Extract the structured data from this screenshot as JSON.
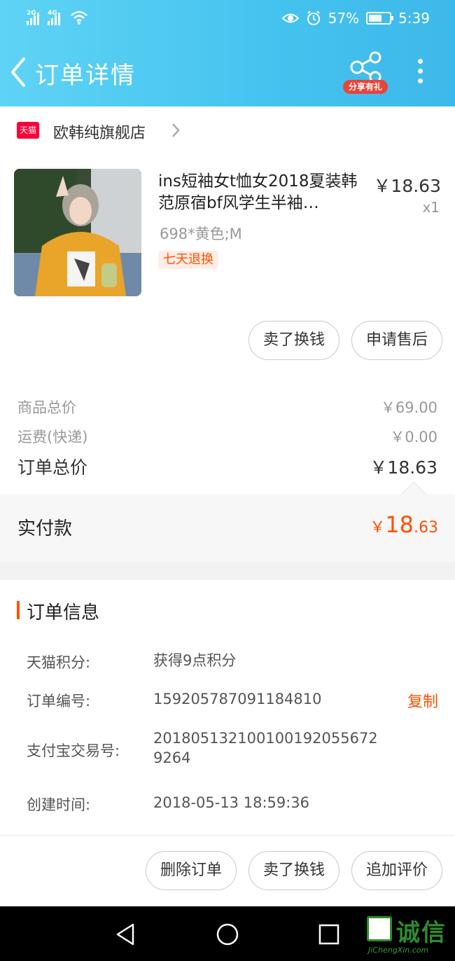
{
  "status_bar": {
    "sim1": "2G",
    "sim2": "4G",
    "battery": "57%",
    "time": "5:39"
  },
  "header": {
    "title": "订单详情",
    "share_label": "分享有礼"
  },
  "shop": {
    "badge": "天猫",
    "name": "欧韩纯旗舰店"
  },
  "product": {
    "title": "ins短袖女t恤女2018夏装韩范原宿bf风学生半袖…",
    "price": "￥18.63",
    "qty": "x1",
    "sku": "698*黄色;M",
    "tag": "七天退换"
  },
  "item_actions": {
    "sell": "卖了换钱",
    "after_sale": "申请售后"
  },
  "summary": {
    "goods_label": "商品总价",
    "goods_value": "￥69.00",
    "shipping_label": "运费(快递)",
    "shipping_value": "￥0.00",
    "order_total_label": "订单总价",
    "order_total_value": "￥18.63",
    "paid_label": "实付款",
    "paid_currency": "￥",
    "paid_int": "18",
    "paid_dec": ".63"
  },
  "order_info": {
    "title": "订单信息",
    "points_label": "天猫积分:",
    "points_value": "获得9点积分",
    "order_no_label": "订单编号:",
    "order_no_value": "159205787091184810",
    "copy_label": "复制",
    "alipay_label": "支付宝交易号:",
    "alipay_value_1": "20180513210010019205567​2",
    "alipay_value_2": "9264",
    "created_label": "创建时间:",
    "created_value": "2018-05-13 18:59:36"
  },
  "bottom_actions": {
    "delete": "删除订单",
    "sell": "卖了换钱",
    "review": "追加评价"
  },
  "watermark": {
    "text": "诚信",
    "sub": "JiChengXin.com"
  },
  "colors": {
    "header": "#45c3ef",
    "accent": "#ff5000",
    "tmall": "#ff0036"
  }
}
